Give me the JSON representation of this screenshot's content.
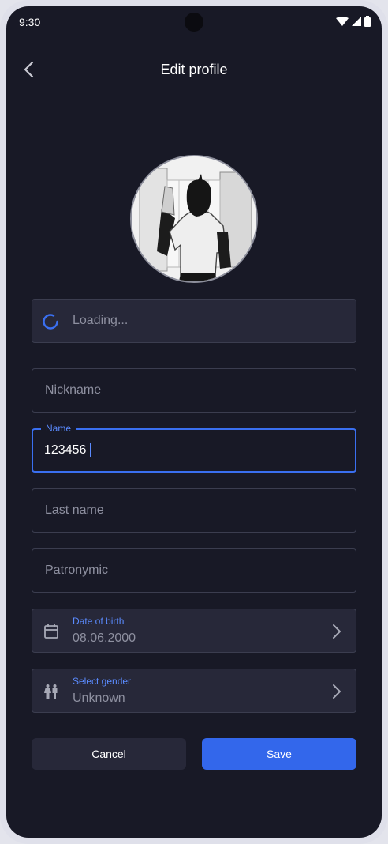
{
  "status_bar": {
    "time": "9:30"
  },
  "header": {
    "title": "Edit profile"
  },
  "loading_field": {
    "text": "Loading..."
  },
  "fields": {
    "nickname": {
      "placeholder": "Nickname",
      "value": ""
    },
    "name": {
      "label": "Name",
      "value": "123456"
    },
    "last_name": {
      "placeholder": "Last name",
      "value": ""
    },
    "patronymic": {
      "placeholder": "Patronymic",
      "value": ""
    }
  },
  "date_of_birth": {
    "label": "Date of birth",
    "value": "08.06.2000",
    "icon": "calendar-icon"
  },
  "gender": {
    "label": "Select gender",
    "value": "Unknown",
    "icon": "gender-icon"
  },
  "actions": {
    "cancel_label": "Cancel",
    "save_label": "Save"
  },
  "colors": {
    "background": "#181926",
    "accent": "#3367eb",
    "field_fill": "#272839"
  }
}
